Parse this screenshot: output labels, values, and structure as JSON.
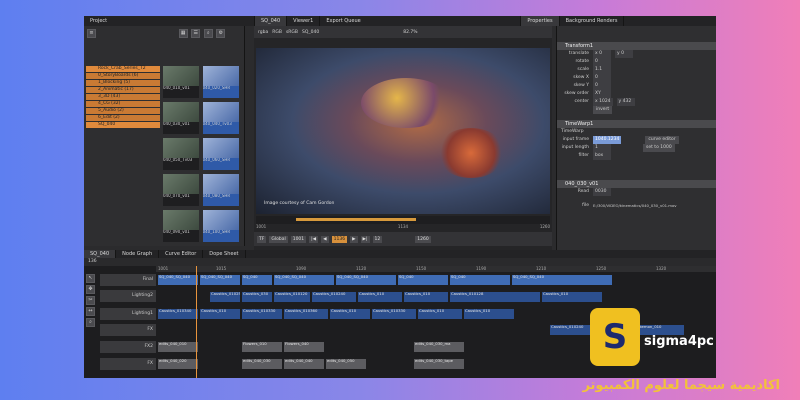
{
  "tabs_top": [
    "Project",
    "SQ_040",
    "Viewer1",
    "Export Queue",
    "Properties",
    "Background Renders"
  ],
  "project": {
    "tree": [
      "Rock_Crab_Series_T2",
      "0_StoryBoards (6)",
      "1_Blocking (5)",
      "2_Animatic (17)",
      "3_3D (43)",
      "4_CG (32)",
      "5_Audio (2)",
      "6_Edit (2)",
      "SQ_040"
    ],
    "thumbs": [
      {
        "label": "040_010_v01",
        "selected": false
      },
      {
        "label": "040_020_SHR",
        "selected": true
      },
      {
        "label": "040_030_v01",
        "selected": false
      },
      {
        "label": "040_040_Tv03",
        "selected": true
      },
      {
        "label": "040_050_Tv03",
        "selected": false
      },
      {
        "label": "040_060_SHR",
        "selected": true
      },
      {
        "label": "040_070_v01",
        "selected": false
      },
      {
        "label": "040_080_SHR",
        "selected": true
      },
      {
        "label": "040_090_v01",
        "selected": false
      },
      {
        "label": "040_100_SHR",
        "selected": true
      }
    ]
  },
  "viewer": {
    "toolbar": [
      "rgba",
      "RGB",
      "sRGB",
      "SQ_040",
      "82.7%"
    ],
    "caption": "Image courtesy of Cam Gordon",
    "ticks": [
      "1001",
      "1134",
      "1260"
    ],
    "transport": {
      "fps": "TF",
      "mode": "Global",
      "frame_in": "1001",
      "current": "1136",
      "frame_out": "1260",
      "loop": "12",
      "end": "1260"
    }
  },
  "properties": {
    "transform_title": "Transform1",
    "transform_rows": [
      {
        "label": "translate",
        "values": [
          "x 0",
          "y 0"
        ]
      },
      {
        "label": "rotate",
        "values": [
          "0"
        ]
      },
      {
        "label": "scale",
        "values": [
          "1.1"
        ]
      },
      {
        "label": "skew X",
        "values": [
          "0"
        ]
      },
      {
        "label": "skew Y",
        "values": [
          "0"
        ]
      },
      {
        "label": "skew order",
        "values": [
          "XY"
        ]
      },
      {
        "label": "center",
        "values": [
          "x 1024",
          "y 432"
        ]
      }
    ],
    "invert_label": "invert",
    "timewarp_title": "TimeWarp1",
    "timewarp_sub": "TimeWarp",
    "timewarp_rows": [
      {
        "label": "input frame",
        "value": "1040.1234",
        "button": "curve editor"
      },
      {
        "label": "input length",
        "value": "1",
        "button": "set to 1000"
      },
      {
        "label": "filter",
        "value": "box"
      }
    ],
    "read_title": "040_030_v01",
    "read_label": "Read",
    "read_value": "0030",
    "file_label": "file",
    "file_value": "E:/300/VIDEO/kinematics/040_030_v01.mov"
  },
  "nodetabs": [
    "SQ_040",
    "Node Graph",
    "Curve Editor",
    "Dope Sheet"
  ],
  "timeline": {
    "toolbar_label": "136",
    "ruler": [
      "1001",
      "1015",
      "1090",
      "1120",
      "1150",
      "1190",
      "1210",
      "1250",
      "1320"
    ],
    "tracks": [
      "Final",
      "Lighting2",
      "Lighting1",
      "FX",
      "FX2",
      "FX"
    ],
    "clips_row1": [
      "SQ_040_SQ_040",
      "SQ_040_SQ_040",
      "SQ_040",
      "SQ_040_SQ_040",
      "SQ_040_SQ_040",
      "SQ_040",
      "SQ_040",
      "SQ_040_SQ_040"
    ],
    "clips_row2": [
      "Caustics_010250",
      "Caustics_030",
      "Caustics_010120",
      "Caustics_010240",
      "Caustics_010",
      "Caustics_010",
      "Caustics_010128",
      "Caustics_010"
    ],
    "clips_row3": [
      "Caustics_010340",
      "Caustics_010",
      "Caustics_010330",
      "Caustics_010360",
      "Caustics_010",
      "Caustics_010330",
      "Caustics_010",
      "Caustics_010"
    ],
    "clips_row4": [
      "Caustics_010240",
      "Caustics_010",
      "Pokemon_010"
    ],
    "clips_row5": [
      "edits_040_010",
      "Flowers_010",
      "Flowers_040",
      "edits_040_030_ma"
    ],
    "clips_row6": [
      "edits_040_020",
      "edits_040_030",
      "edits_040_040",
      "edits_040_050",
      "edits_040_030_tape"
    ]
  },
  "brand": {
    "logo_letter": "S",
    "name": "sigma4pc",
    "arabic": "اكاديمية سيجما لعلوم الكمبيوتر"
  }
}
